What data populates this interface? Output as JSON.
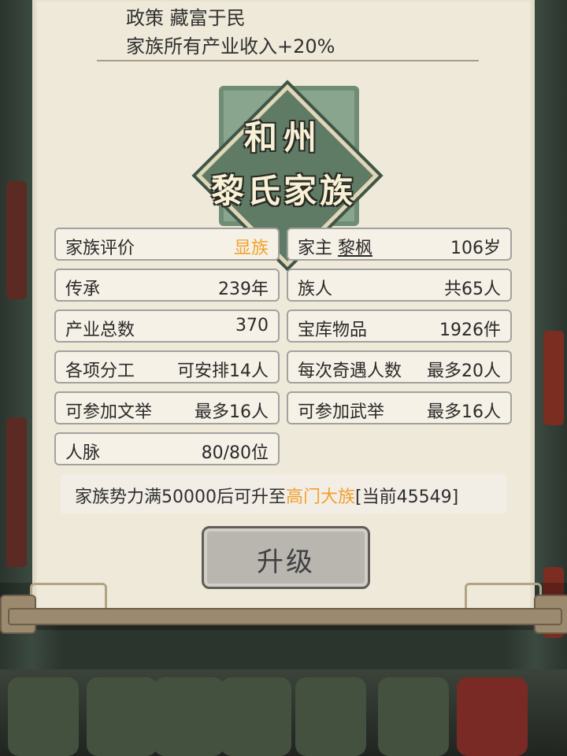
{
  "policy": {
    "title": "政策 藏富于民",
    "description": "家族所有产业收入+20%"
  },
  "emblem": {
    "line1": "和州",
    "line2": "黎氏家族"
  },
  "stats": [
    {
      "label": "家族评价",
      "value": "显族",
      "value_color": "#f1a02d"
    },
    {
      "label": "家主",
      "name": "黎枫",
      "value": "106岁"
    },
    {
      "label": "传承",
      "value": "239年"
    },
    {
      "label": "族人",
      "value": "共65人"
    },
    {
      "label": "产业总数",
      "value": "370"
    },
    {
      "label": "宝库物品",
      "value": "1926件"
    },
    {
      "label": "各项分工",
      "value": "可安排14人"
    },
    {
      "label": "每次奇遇人数",
      "value": "最多20人"
    },
    {
      "label": "可参加文举",
      "value": "最多16人"
    },
    {
      "label": "可参加武举",
      "value": "最多16人"
    },
    {
      "label": "人脉",
      "value": "80/80位"
    }
  ],
  "requirement": {
    "prefix": "家族势力满50000后可升至",
    "target": "高门大族",
    "current": "[当前45549]"
  },
  "button": {
    "upgrade_label": "升级"
  }
}
